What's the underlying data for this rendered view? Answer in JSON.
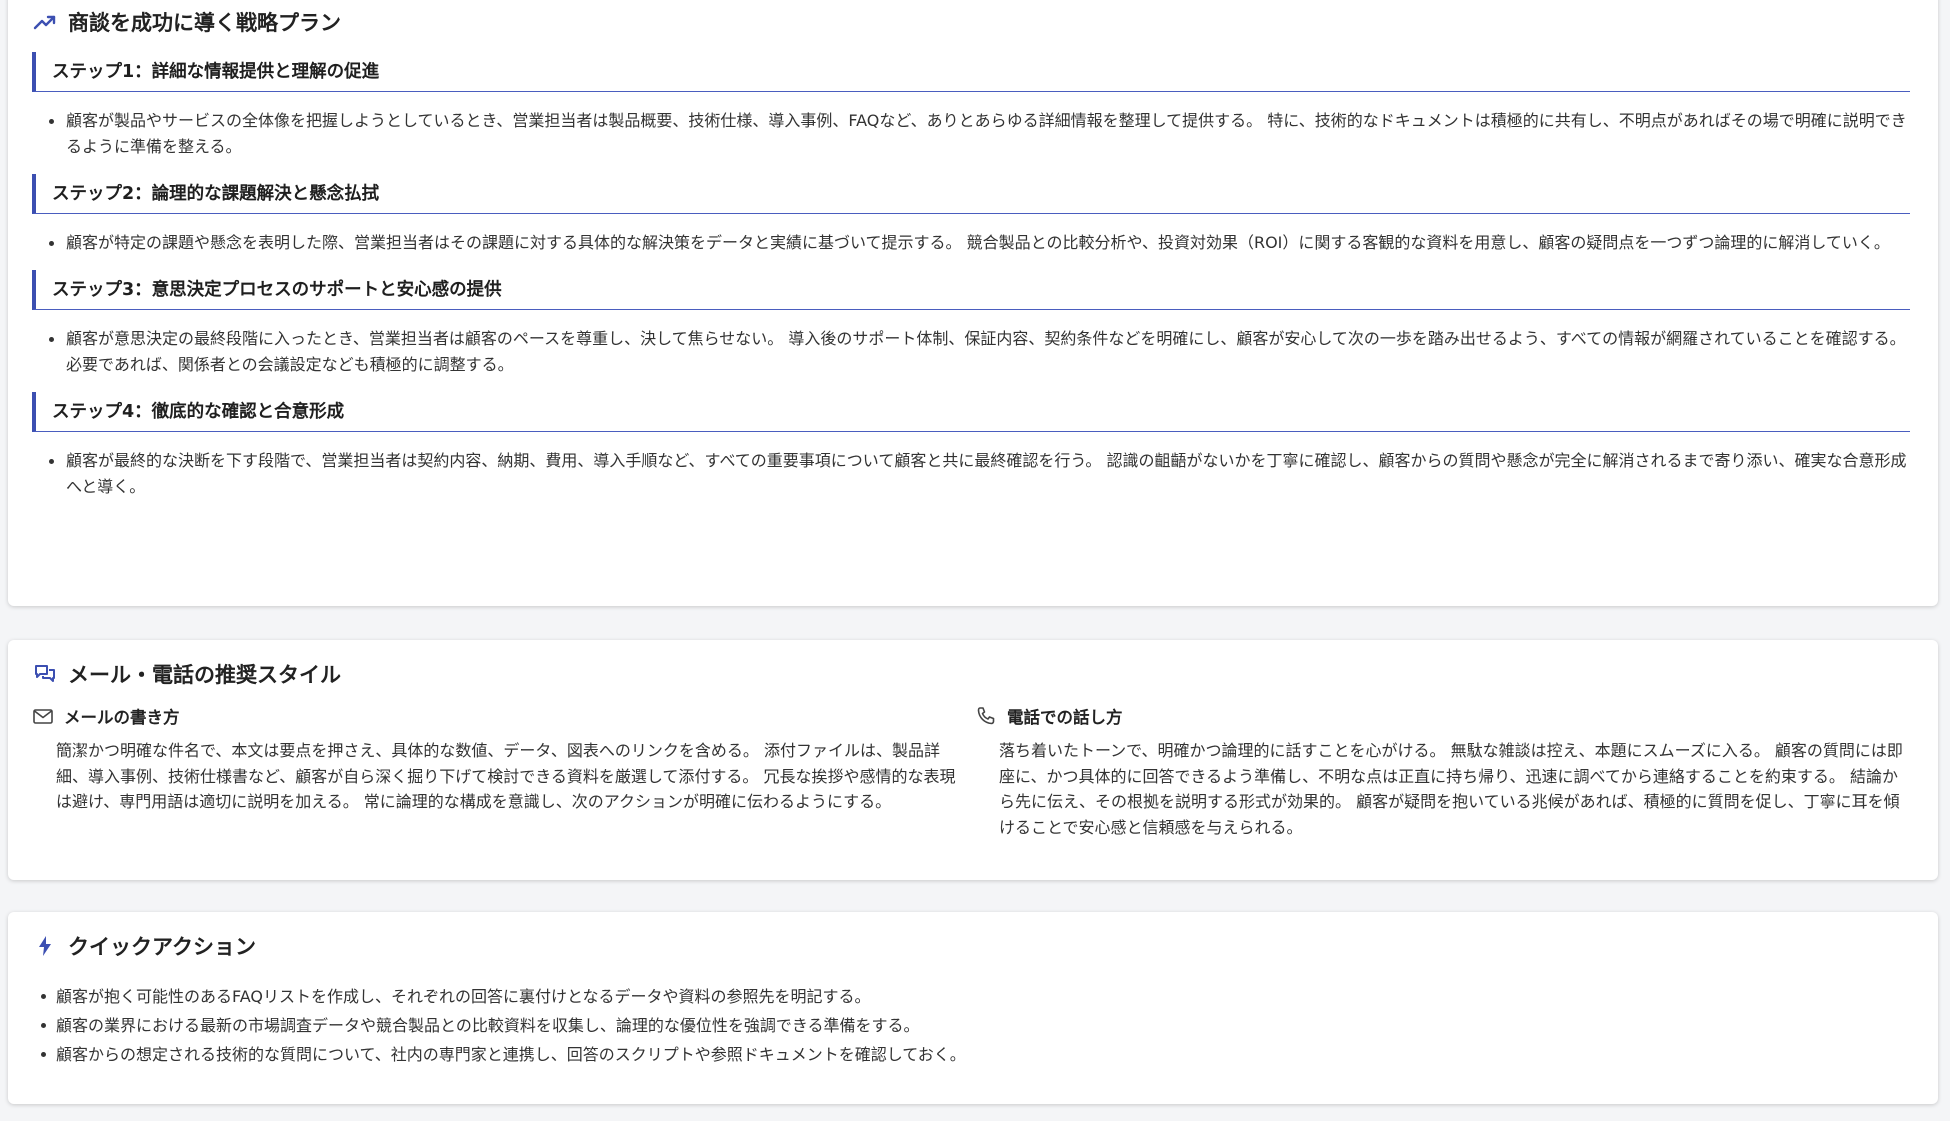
{
  "colors": {
    "accent": "#3c4fb1",
    "text": "#333333",
    "card_bg": "#ffffff",
    "page_bg": "#f4f5f7"
  },
  "strategy": {
    "title": "商談を成功に導く戦略プラン",
    "icon": "trending-up-icon",
    "steps": [
      {
        "heading": "ステップ1：詳細な情報提供と理解の促進",
        "text": "顧客が製品やサービスの全体像を把握しようとしているとき、営業担当者は製品概要、技術仕様、導入事例、FAQなど、ありとあらゆる詳細情報を整理して提供する。 特に、技術的なドキュメントは積極的に共有し、不明点があればその場で明確に説明できるように準備を整える。"
      },
      {
        "heading": "ステップ2：論理的な課題解決と懸念払拭",
        "text": "顧客が特定の課題や懸念を表明した際、営業担当者はその課題に対する具体的な解決策をデータと実績に基づいて提示する。 競合製品との比較分析や、投資対効果（ROI）に関する客観的な資料を用意し、顧客の疑問点を一つずつ論理的に解消していく。"
      },
      {
        "heading": "ステップ3：意思決定プロセスのサポートと安心感の提供",
        "text": "顧客が意思決定の最終段階に入ったとき、営業担当者は顧客のペースを尊重し、決して焦らせない。 導入後のサポート体制、保証内容、契約条件などを明確にし、顧客が安心して次の一歩を踏み出せるよう、すべての情報が網羅されていることを確認する。 必要であれば、関係者との会議設定なども積極的に調整する。"
      },
      {
        "heading": "ステップ4：徹底的な確認と合意形成",
        "text": "顧客が最終的な決断を下す段階で、営業担当者は契約内容、納期、費用、導入手順など、すべての重要事項について顧客と共に最終確認を行う。 認識の齟齬がないかを丁寧に確認し、顧客からの質問や懸念が完全に解消されるまで寄り添い、確実な合意形成へと導く。"
      }
    ]
  },
  "style": {
    "title": "メール・電話の推奨スタイル",
    "icon": "chat-bubbles-icon",
    "email": {
      "icon": "mail-icon",
      "title": "メールの書き方",
      "text": "簡潔かつ明確な件名で、本文は要点を押さえ、具体的な数値、データ、図表へのリンクを含める。 添付ファイルは、製品詳細、導入事例、技術仕様書など、顧客が自ら深く掘り下げて検討できる資料を厳選して添付する。 冗長な挨拶や感情的な表現は避け、専門用語は適切に説明を加える。 常に論理的な構成を意識し、次のアクションが明確に伝わるようにする。"
    },
    "phone": {
      "icon": "phone-icon",
      "title": "電話での話し方",
      "text": "落ち着いたトーンで、明確かつ論理的に話すことを心がける。 無駄な雑談は控え、本題にスムーズに入る。 顧客の質問には即座に、かつ具体的に回答できるよう準備し、不明な点は正直に持ち帰り、迅速に調べてから連絡することを約束する。 結論から先に伝え、その根拠を説明する形式が効果的。 顧客が疑問を抱いている兆候があれば、積極的に質問を促し、丁寧に耳を傾けることで安心感と信頼感を与えられる。"
    }
  },
  "quick": {
    "title": "クイックアクション",
    "icon": "lightning-icon",
    "items": [
      "顧客が抱く可能性のあるFAQリストを作成し、それぞれの回答に裏付けとなるデータや資料の参照先を明記する。",
      "顧客の業界における最新の市場調査データや競合製品との比較資料を収集し、論理的な優位性を強調できる準備をする。",
      "顧客からの想定される技術的な質問について、社内の専門家と連携し、回答のスクリプトや参照ドキュメントを確認しておく。"
    ]
  }
}
